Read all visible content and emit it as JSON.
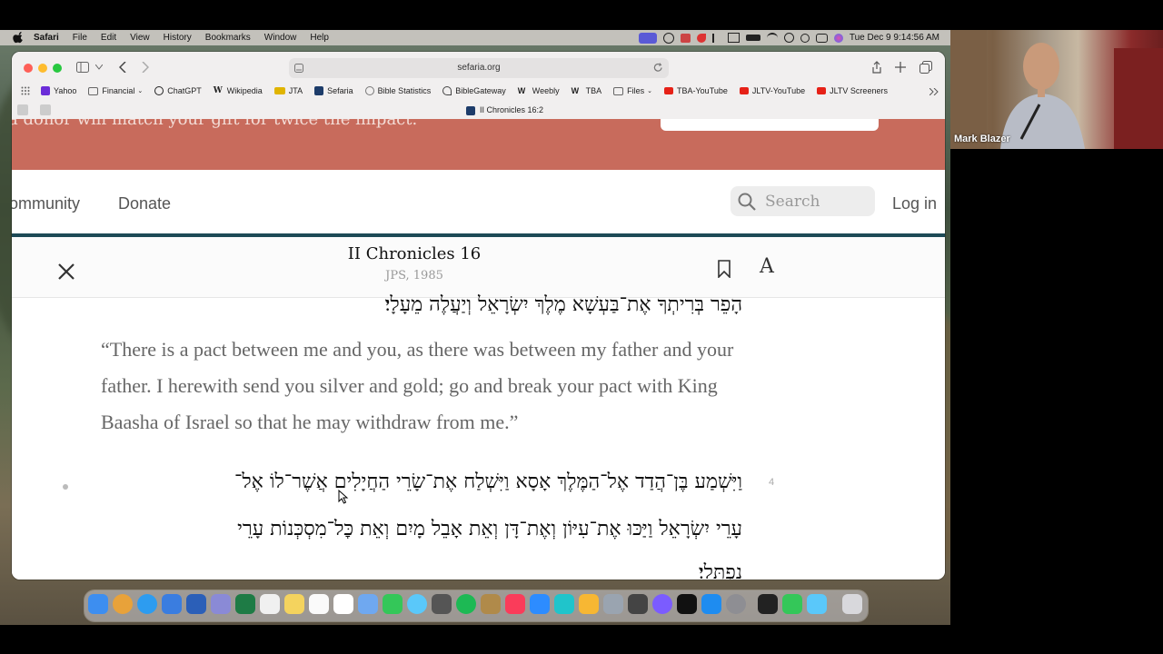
{
  "menubar": {
    "app": "Safari",
    "items": [
      "File",
      "Edit",
      "View",
      "History",
      "Bookmarks",
      "Window",
      "Help"
    ],
    "clock": "Tue Dec 9  9:14:56 AM"
  },
  "webcam": {
    "participant": "Mark Blazer"
  },
  "browser": {
    "url": "sefaria.org",
    "tab_title": "II Chronicles 16:2",
    "bookmarks": [
      {
        "label": "Yahoo",
        "color": "#6b2dd8"
      },
      {
        "label": "Financial",
        "color": "#666666",
        "dropdown": true
      },
      {
        "label": "ChatGPT",
        "color": "#222222"
      },
      {
        "label": "Wikipedia",
        "color": "#333333"
      },
      {
        "label": "JTA",
        "color": "#e0b400"
      },
      {
        "label": "Sefaria",
        "color": "#1d3c6a"
      },
      {
        "label": "Bible Statistics",
        "color": "#777777"
      },
      {
        "label": "BibleGateway",
        "color": "#444444"
      },
      {
        "label": "Weebly",
        "color": "#333333"
      },
      {
        "label": "TBA",
        "color": "#333333"
      },
      {
        "label": "Files",
        "color": "#777777",
        "dropdown": true
      },
      {
        "label": "TBA-YouTube",
        "color": "#e62117"
      },
      {
        "label": "JLTV-YouTube",
        "color": "#e62117"
      },
      {
        "label": "JLTV Screeners",
        "color": "#e62117"
      }
    ]
  },
  "page": {
    "banner_text": "a donor will match your gift for twice the impact.",
    "nav": {
      "community": "ommunity",
      "donate": "Donate",
      "search_placeholder": "Search",
      "login": "Log in"
    },
    "reader": {
      "title": "II Chronicles 16",
      "version": "JPS, 1985",
      "hebrew_prev_line": "הָפֵר בְּרִיתְךָ אֶת־בַּעְשָׁא מֶלֶךְ יִשְׂרָאֵל וְיַעֲלֶה מֵעָלָי׃",
      "english": "“There is a pact between me and you, as there was between my father and your father. I herewith send you silver and gold; go and break your pact with King Baasha of Israel so that he may withdraw from me.”",
      "verse_number": "4",
      "hebrew_line1": "וַיִּשְׁמַע בֶּן־הֲדַד אֶל־הַמֶּלֶךְ אָסָא וַיִּשְׁלַח אֶת־שָׂרֵי הַחֲיָלִים אֲשֶׁר־לוֹ אֶל־",
      "hebrew_line2": "עָרֵי יִשְׂרָאֵל וַיַּכּוּ אֶת־עִיּוֹן וְאֶת־דָּן וְאֵת אָבֵל מָיִם וְאֵת כׇּל־מִסְכְּנוֹת עָרֵי",
      "hebrew_line3": "נַפְתָּלִי׃"
    }
  },
  "colors": {
    "banner": "#c86b5c",
    "accent_bar": "#1d4a56"
  }
}
